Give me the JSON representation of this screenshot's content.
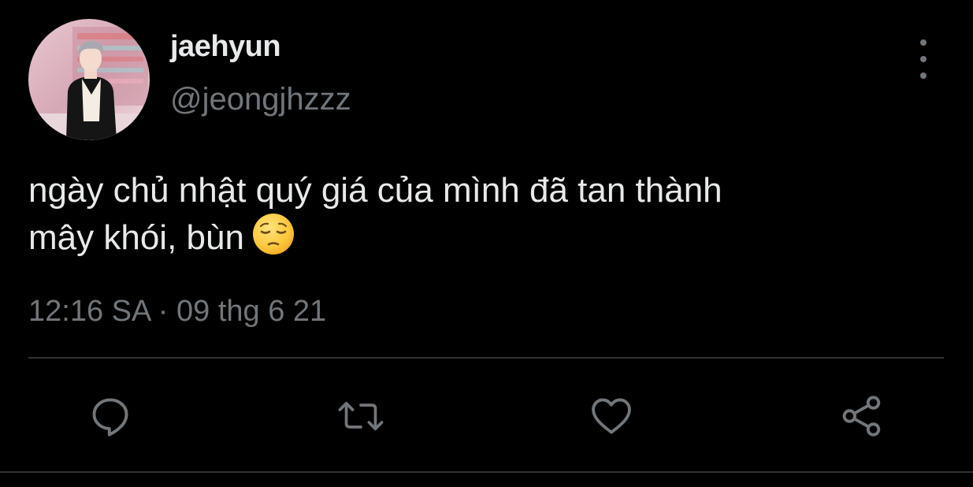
{
  "author": {
    "display_name": "jaehyun",
    "handle": "@jeongjhzzz",
    "avatar_icon": "profile-photo"
  },
  "tweet": {
    "text_line_1": "ngày chủ nhật quý giá của mình đã tan thành",
    "text_line_2": "mây khói, bùn",
    "emoji": "pensive-face-emoji",
    "timestamp": "12:16 SA · 09 thg 6 21"
  },
  "actions": {
    "reply_icon": "reply-icon",
    "retweet_icon": "retweet-icon",
    "like_icon": "heart-icon",
    "share_icon": "share-icon",
    "more_icon": "more-options-icon"
  },
  "colors": {
    "background": "#000000",
    "primary_text": "#e7e9ea",
    "secondary_text": "#71767b",
    "divider": "#2f3336"
  }
}
